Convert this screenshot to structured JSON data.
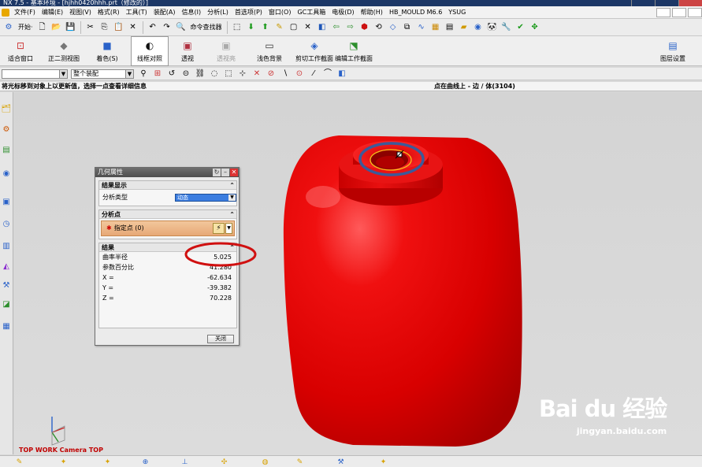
{
  "window": {
    "title": "NX 7.5 - 基本环境 - [hjhh0420hhh.prt（修改的）]"
  },
  "menubar": {
    "items": [
      "文件(F)",
      "编辑(E)",
      "视图(V)",
      "格式(R)",
      "工具(T)",
      "装配(A)",
      "信息(I)",
      "分析(L)",
      "首选项(P)",
      "窗口(O)",
      "GC工具箱",
      "电极(D)",
      "帮助(H)",
      "HB_MOULD M6.6",
      "YSUG"
    ]
  },
  "toolbar1": {
    "start_label": "开始·",
    "command_finder_label": "命令查找器"
  },
  "ribbon": {
    "fit_label": "适合窗口",
    "trimetric_label": "正二测视图",
    "shading_label": "着色(S)",
    "wireframe_label": "线框对照",
    "perspective_label": "透视",
    "see_through_label": "透视亮",
    "light_bg_label": "浅色背景",
    "clip_section_label": "剪切工作截面",
    "edit_section_label": "编辑工作截面",
    "layer_settings_label": "图层设置"
  },
  "toolbar2": {
    "filter_value": "",
    "assembly_scope_value": "整个装配"
  },
  "status": {
    "prompt": "将光标移到对象上以更新值，选择一点查看详细信息",
    "info": "点在曲线上 - 边 / 体(3104)"
  },
  "viewport": {
    "view_label": "TOP WORK Camera TOP"
  },
  "dialog": {
    "title": "几何属性",
    "section_display": "结果显示",
    "analysis_type_label": "分析类型",
    "analysis_type_value": "动态",
    "section_point": "分析点",
    "specify_point_label": "指定点 (0)",
    "section_results": "结果",
    "results": [
      {
        "label": "曲率半径",
        "value": "5.025"
      },
      {
        "label": "参数百分比",
        "value": "41.280"
      },
      {
        "label": "X =",
        "value": "-62.634"
      },
      {
        "label": "Y =",
        "value": "-39.382"
      },
      {
        "label": "Z =",
        "value": "70.228"
      }
    ],
    "close_label": "关闭"
  },
  "watermark": {
    "brand": "Bai du 经验",
    "url": "jingyan.baidu.com"
  },
  "colors": {
    "model_red": "#e00000",
    "annotation_red": "#d01010",
    "annotation_blue": "#3c5a9a",
    "dialog_orange": "#e7a876",
    "title_blue": "#1c3766"
  }
}
